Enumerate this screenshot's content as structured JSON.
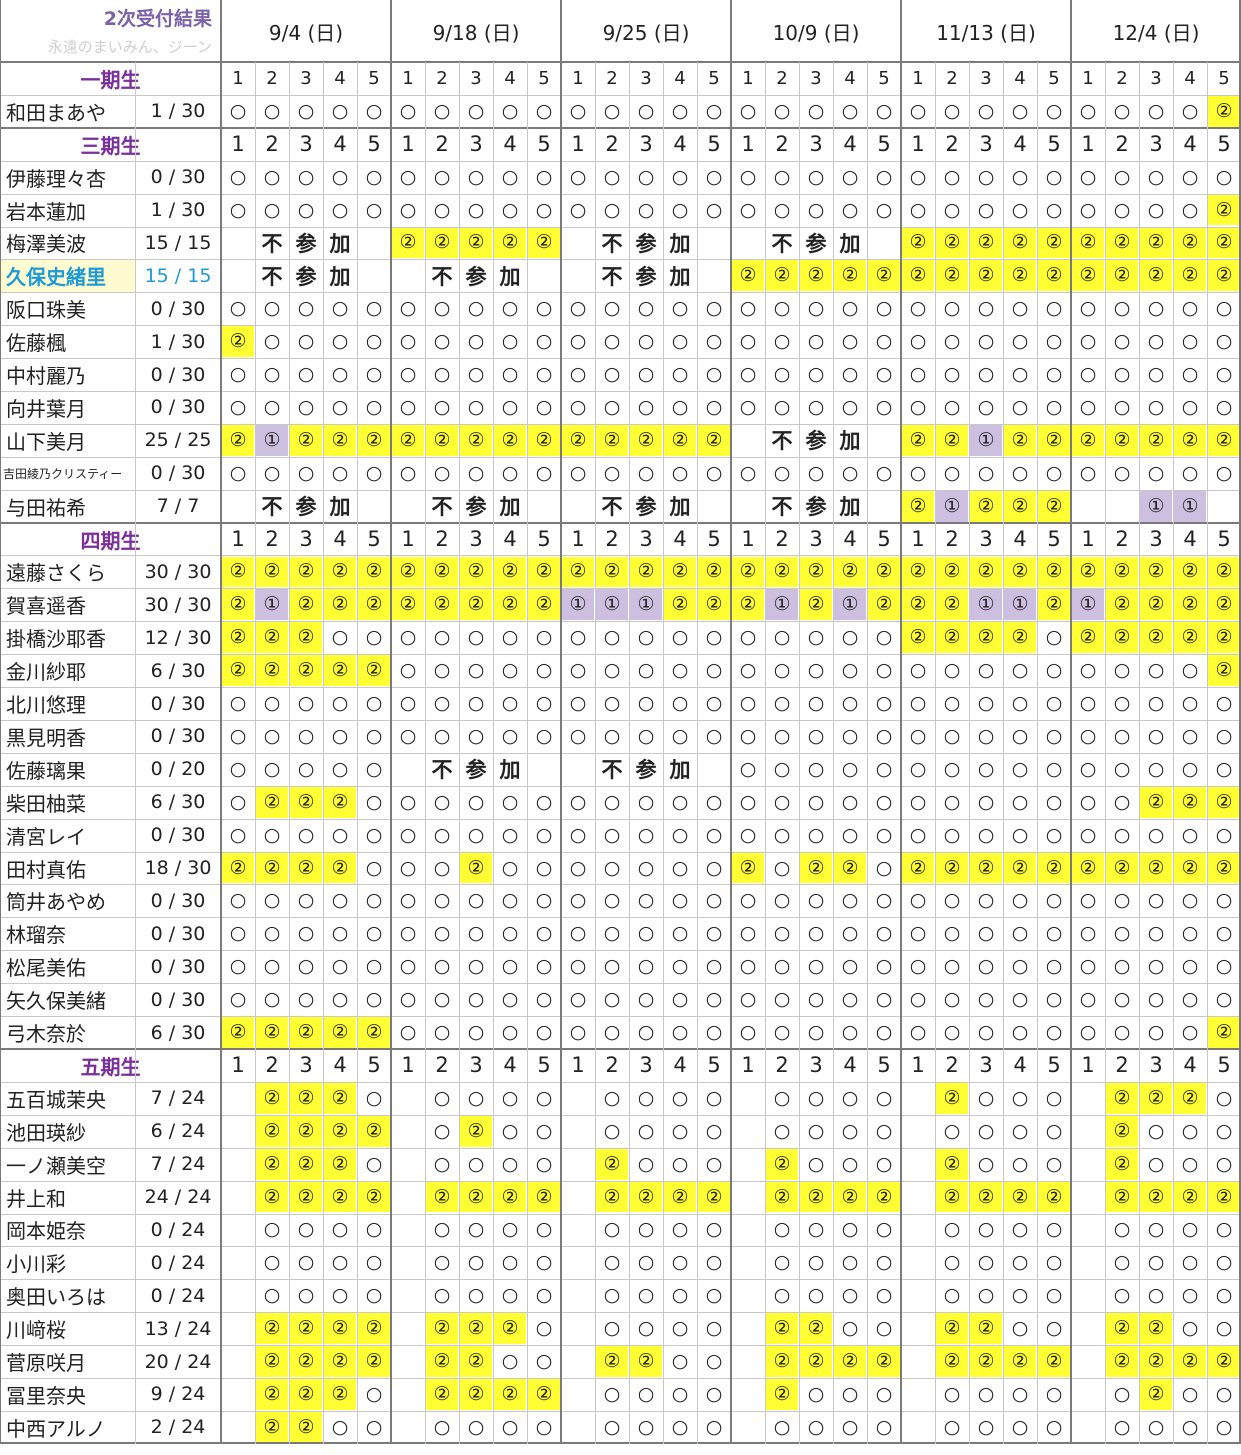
{
  "title": "2次受付結果",
  "subtitle": "永遠のまいみん、ジーン",
  "dates": [
    "9/4 (日)",
    "9/18 (日)",
    "9/25 (日)",
    "10/9 (日)",
    "11/13 (日)",
    "12/4 (日)"
  ],
  "parts": [
    "1",
    "2",
    "3",
    "4",
    "5"
  ],
  "absent_text": "不参加",
  "legend": {
    "A": "○",
    "B": "①",
    "C": "②"
  },
  "groups": [
    {
      "label": "一期生",
      "members": [
        {
          "name": "和田まあや",
          "count": "1 / 30",
          "slots": [
            "AAAAA",
            "AAAAA",
            "AAAAA",
            "AAAAA",
            "AAAAA",
            "AAAAC"
          ]
        }
      ]
    },
    {
      "label": "三期生",
      "members": [
        {
          "name": "伊藤理々杏",
          "count": "0 / 30",
          "slots": [
            "AAAAA",
            "AAAAA",
            "AAAAA",
            "AAAAA",
            "AAAAA",
            "AAAAA"
          ]
        },
        {
          "name": "岩本蓮加",
          "count": "1 / 30",
          "slots": [
            "AAAAA",
            "AAAAA",
            "AAAAA",
            "AAAAA",
            "AAAAA",
            "AAAAC"
          ]
        },
        {
          "name": "梅澤美波",
          "count": "15 / 15",
          "slots": [
            "X",
            "CCCCC",
            "X",
            "X",
            "CCCCC",
            "CCCCC"
          ]
        },
        {
          "name": "久保史緒里",
          "count": "15 / 15",
          "highlight": true,
          "slots": [
            "X",
            "X",
            "X",
            "CCCCC",
            "CCCCC",
            "CCCCC"
          ]
        },
        {
          "name": "阪口珠美",
          "count": "0 / 30",
          "slots": [
            "AAAAA",
            "AAAAA",
            "AAAAA",
            "AAAAA",
            "AAAAA",
            "AAAAA"
          ]
        },
        {
          "name": "佐藤楓",
          "count": "1 / 30",
          "slots": [
            "CAAAA",
            "AAAAA",
            "AAAAA",
            "AAAAA",
            "AAAAA",
            "AAAAA"
          ]
        },
        {
          "name": "中村麗乃",
          "count": "0 / 30",
          "slots": [
            "AAAAA",
            "AAAAA",
            "AAAAA",
            "AAAAA",
            "AAAAA",
            "AAAAA"
          ]
        },
        {
          "name": "向井葉月",
          "count": "0 / 30",
          "slots": [
            "AAAAA",
            "AAAAA",
            "AAAAA",
            "AAAAA",
            "AAAAA",
            "AAAAA"
          ]
        },
        {
          "name": "山下美月",
          "count": "25 / 25",
          "slots": [
            "CBCCC",
            "CCCCC",
            "CCCCC",
            "X",
            "CCBCC",
            "CCCCC"
          ]
        },
        {
          "name": "吉田綾乃クリスティー",
          "count": "0 / 30",
          "small": true,
          "slots": [
            "AAAAA",
            "AAAAA",
            "AAAAA",
            "AAAAA",
            "AAAAA",
            "AAAAA"
          ]
        },
        {
          "name": "与田祐希",
          "count": "7 / 7",
          "slots": [
            "X",
            "X",
            "X",
            "X",
            "CBCCC",
            "  BB "
          ]
        }
      ]
    },
    {
      "label": "四期生",
      "members": [
        {
          "name": "遠藤さくら",
          "count": "30 / 30",
          "slots": [
            "CCCCC",
            "CCCCC",
            "CCCCC",
            "CCCCC",
            "CCCCC",
            "CCCCC"
          ]
        },
        {
          "name": "賀喜遥香",
          "count": "30 / 30",
          "slots": [
            "CBCCC",
            "CCCCC",
            "BBBCC",
            "CBCBC",
            "CCBBC",
            "BCCCC"
          ]
        },
        {
          "name": "掛橋沙耶香",
          "count": "12 / 30",
          "slots": [
            "CCCAA",
            "AAAAA",
            "AAAAA",
            "AAAAA",
            "CCCCA",
            "CCCCC"
          ]
        },
        {
          "name": "金川紗耶",
          "count": "6 / 30",
          "slots": [
            "CCCCC",
            "AAAAA",
            "AAAAA",
            "AAAAA",
            "AAAAA",
            "AAAAC"
          ]
        },
        {
          "name": "北川悠理",
          "count": "0 / 30",
          "slots": [
            "AAAAA",
            "AAAAA",
            "AAAAA",
            "AAAAA",
            "AAAAA",
            "AAAAA"
          ]
        },
        {
          "name": "黒見明香",
          "count": "0 / 30",
          "slots": [
            "AAAAA",
            "AAAAA",
            "AAAAA",
            "AAAAA",
            "AAAAA",
            "AAAAA"
          ]
        },
        {
          "name": "佐藤璃果",
          "count": "0 / 20",
          "slots": [
            "AAAAA",
            "X",
            "X",
            "AAAAA",
            "AAAAA",
            "AAAAA"
          ]
        },
        {
          "name": "柴田柚菜",
          "count": "6 / 30",
          "slots": [
            "ACCCA",
            "AAAAA",
            "AAAAA",
            "AAAAA",
            "AAAAA",
            "AACCC"
          ]
        },
        {
          "name": "清宮レイ",
          "count": "0 / 30",
          "slots": [
            "AAAAA",
            "AAAAA",
            "AAAAA",
            "AAAAA",
            "AAAAA",
            "AAAAA"
          ]
        },
        {
          "name": "田村真佑",
          "count": "18 / 30",
          "slots": [
            "CCCCA",
            "AACAA",
            "AAAAA",
            "CACCA",
            "CCCCC",
            "CCCCC"
          ]
        },
        {
          "name": "筒井あやめ",
          "count": "0 / 30",
          "slots": [
            "AAAAA",
            "AAAAA",
            "AAAAA",
            "AAAAA",
            "AAAAA",
            "AAAAA"
          ]
        },
        {
          "name": "林瑠奈",
          "count": "0 / 30",
          "slots": [
            "AAAAA",
            "AAAAA",
            "AAAAA",
            "AAAAA",
            "AAAAA",
            "AAAAA"
          ]
        },
        {
          "name": "松尾美佑",
          "count": "0 / 30",
          "slots": [
            "AAAAA",
            "AAAAA",
            "AAAAA",
            "AAAAA",
            "AAAAA",
            "AAAAA"
          ]
        },
        {
          "name": "矢久保美緒",
          "count": "0 / 30",
          "slots": [
            "AAAAA",
            "AAAAA",
            "AAAAA",
            "AAAAA",
            "AAAAA",
            "AAAAA"
          ]
        },
        {
          "name": "弓木奈於",
          "count": "6 / 30",
          "slots": [
            "CCCCC",
            "AAAAA",
            "AAAAA",
            "AAAAA",
            "AAAAA",
            "AAAAC"
          ]
        }
      ]
    },
    {
      "label": "五期生",
      "members": [
        {
          "name": "五百城茉央",
          "count": "7 / 24",
          "slots": [
            " CCCA",
            " AAAA",
            " AAAA",
            " AAAA",
            " CAAA",
            " CCCA"
          ]
        },
        {
          "name": "池田瑛紗",
          "count": "6 / 24",
          "slots": [
            " CCCC",
            " ACAA",
            " AAAA",
            " AAAA",
            " AAAA",
            " CAAA"
          ]
        },
        {
          "name": "一ノ瀬美空",
          "count": "7 / 24",
          "slots": [
            " CCCA",
            " AAAA",
            " CAAA",
            " CAAA",
            " CAAA",
            " CAAA"
          ]
        },
        {
          "name": "井上和",
          "count": "24 / 24",
          "slots": [
            " CCCC",
            " CCCC",
            " CCCC",
            " CCCC",
            " CCCC",
            " CCCC"
          ]
        },
        {
          "name": "岡本姫奈",
          "count": "0 / 24",
          "slots": [
            " AAAA",
            " AAAA",
            " AAAA",
            " AAAA",
            " AAAA",
            " AAAA"
          ]
        },
        {
          "name": "小川彩",
          "count": "0 / 24",
          "slots": [
            " AAAA",
            " AAAA",
            " AAAA",
            " AAAA",
            " AAAA",
            " AAAA"
          ]
        },
        {
          "name": "奥田いろは",
          "count": "0 / 24",
          "slots": [
            " AAAA",
            " AAAA",
            " AAAA",
            " AAAA",
            " AAAA",
            " AAAA"
          ]
        },
        {
          "name": "川﨑桜",
          "count": "13 / 24",
          "slots": [
            " CCCC",
            " CCCA",
            " AAAA",
            " CCAA",
            " CCAA",
            " CCAA"
          ]
        },
        {
          "name": "菅原咲月",
          "count": "20 / 24",
          "slots": [
            " CCCC",
            " CCAA",
            " CCAA",
            " CCCC",
            " CCCC",
            " CCCC"
          ]
        },
        {
          "name": "冨里奈央",
          "count": "9 / 24",
          "slots": [
            " CCCA",
            " CCCC",
            " AAAA",
            " CAAA",
            " AAAA",
            " ACAA"
          ]
        },
        {
          "name": "中西アルノ",
          "count": "2 / 24",
          "slots": [
            " CCAA",
            " AAAA",
            " AAAA",
            " AAAA",
            " AAAA",
            " AAAA"
          ]
        }
      ]
    }
  ]
}
